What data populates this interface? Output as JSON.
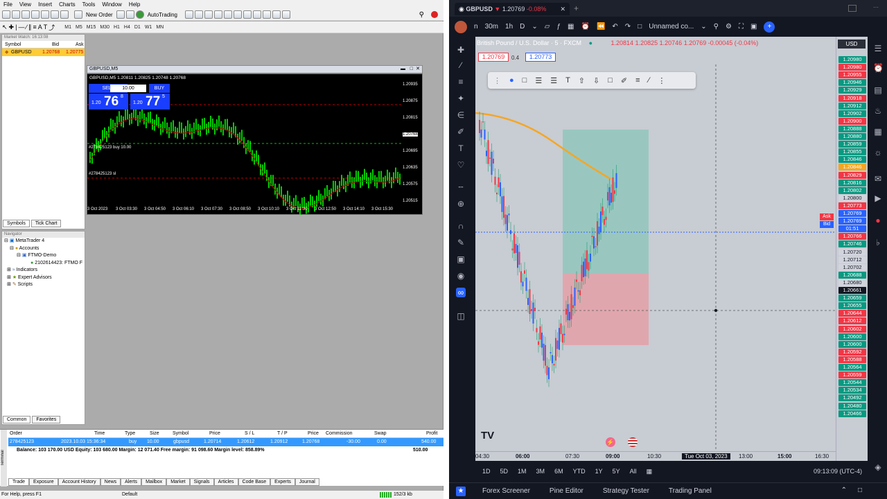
{
  "mt4": {
    "menu": [
      "File",
      "View",
      "Insert",
      "Charts",
      "Tools",
      "Window",
      "Help"
    ],
    "toolbar": {
      "new_order": "New Order",
      "autotrading": "AutoTrading"
    },
    "timeframes": [
      "M1",
      "M5",
      "M15",
      "M30",
      "H1",
      "H4",
      "D1",
      "W1",
      "MN"
    ],
    "market_watch": {
      "title": "Market Watch: 16:13:08",
      "headers": [
        "Symbol",
        "Bid",
        "Ask"
      ],
      "rows": [
        {
          "symbol": "GBPUSD",
          "bid": "1.20768",
          "ask": "1.20775"
        }
      ],
      "tabs": [
        "Symbols",
        "Tick Chart"
      ]
    },
    "navigator": {
      "title": "Navigator",
      "items": [
        "MetaTrader 4",
        "Accounts",
        "FTMO-Demo",
        "2102614423: FTMO F",
        "Indicators",
        "Expert Advisors",
        "Scripts"
      ],
      "tabs": [
        "Common",
        "Favorites"
      ]
    },
    "chart": {
      "title": "GBPUSD,M5",
      "ohlc": "GBPUSD,M5  1.20811 1.20825 1.20748 1.20768",
      "sell_label": "SELL",
      "buy_label": "BUY",
      "lot": "10.00",
      "sell_price_small": "1.20",
      "sell_price_big": "76",
      "sell_price_sup": "8",
      "buy_price_small": "1.20",
      "buy_price_big": "77",
      "buy_price_sup": "5",
      "order_label_1": "#278425123 buy 10.00",
      "order_label_2": "#278425123 sl",
      "price_scale": [
        "1.20935",
        "1.20875",
        "1.20815",
        "1.20768",
        "1.20695",
        "1.20635",
        "1.20575",
        "1.20515"
      ],
      "time_scale": [
        "3 Oct 2023",
        "3 Oct 03:30",
        "3 Oct 04:50",
        "3 Oct 06:10",
        "3 Oct 07:30",
        "3 Oct 08:50",
        "3 Oct 10:10",
        "3 Oct 11:30",
        "3 Oct 12:50",
        "3 Oct 14:10",
        "3 Oct 15:30"
      ]
    },
    "terminal": {
      "headers": [
        "Order",
        "Time",
        "Type",
        "Size",
        "Symbol",
        "Price",
        "S / L",
        "T / P",
        "Price",
        "Commission",
        "Swap",
        "Profit"
      ],
      "row": [
        "278425123",
        "2023.10.03 15:36:34",
        "buy",
        "10.00",
        "gbpusd",
        "1.20714",
        "1.20612",
        "1.20912",
        "1.20768",
        "-30.00",
        "0.00",
        "540.00"
      ],
      "balance_line": "Balance: 103 170.00 USD  Equity: 103 680.00  Margin: 12 071.40  Free margin: 91 098.60  Margin level: 858.89%",
      "balance_profit": "510.00",
      "tabs": [
        "Trade",
        "Exposure",
        "Account History",
        "News",
        "Alerts",
        "Mailbox",
        "Market",
        "Signals",
        "Articles",
        "Code Base",
        "Experts",
        "Journal"
      ],
      "side_label": "Terminal"
    },
    "status": {
      "help": "For Help, press F1",
      "profile": "Default",
      "traffic": "152/3 kb"
    }
  },
  "tv": {
    "tab_title": "GBPUSD",
    "tab_price": "1.20769",
    "tab_change": "-0.08%",
    "top": {
      "interval": "30m",
      "tf1": "1h",
      "tf2": "D",
      "layout": "Unnamed co..."
    },
    "legend": {
      "name": "British Pound / U.S. Dollar · 5 · FXCM",
      "o": "1.20814",
      "h": "1.20825",
      "l": "1.20746",
      "c": "1.20769",
      "chg": "-0.00045 (-0.04%)",
      "bid_box": "1.20769",
      "spread": "0.4",
      "ask_box": "1.20773"
    },
    "currency": "USD",
    "colors": {
      "up": "#2962ff",
      "down": "#f23645",
      "sma": "#f5a623",
      "tp_zone": "#7fc4b6",
      "sl_zone": "#e89aa2"
    },
    "price_labels": [
      {
        "v": "1.20980",
        "c": "#089981"
      },
      {
        "v": "1.20980",
        "c": "#f23645"
      },
      {
        "v": "1.20955",
        "c": "#f23645"
      },
      {
        "v": "1.20946",
        "c": "#089981"
      },
      {
        "v": "1.20929",
        "c": "#089981"
      },
      {
        "v": "1.20918",
        "c": "#f23645"
      },
      {
        "v": "1.20912",
        "c": "#089981"
      },
      {
        "v": "1.20902",
        "c": "#089981"
      },
      {
        "v": "1.20900",
        "c": "#f23645"
      },
      {
        "v": "1.20888",
        "c": "#089981"
      },
      {
        "v": "1.20880",
        "c": "#089981"
      },
      {
        "v": "1.20859",
        "c": "#089981"
      },
      {
        "v": "1.20855",
        "c": "#089981"
      },
      {
        "v": "1.20846",
        "c": "#089981"
      },
      {
        "v": "1.20846",
        "c": "#f5a623"
      },
      {
        "v": "1.20829",
        "c": "#f23645"
      },
      {
        "v": "1.20816",
        "c": "#089981"
      },
      {
        "v": "1.20802",
        "c": "#089981"
      },
      {
        "v": "1.20800",
        "c": "#d1d4dc"
      },
      {
        "v": "1.20773",
        "c": "#f23645"
      },
      {
        "v": "1.20769",
        "c": "#2962ff"
      },
      {
        "v": "1.20769",
        "c": "#2962ff"
      },
      {
        "v": "01:51",
        "c": "#2962ff"
      },
      {
        "v": "1.20766",
        "c": "#f23645"
      },
      {
        "v": "1.20746",
        "c": "#089981"
      },
      {
        "v": "1.20720",
        "c": "#d1d4dc"
      },
      {
        "v": "1.20712",
        "c": "#d1d4dc"
      },
      {
        "v": "1.20702",
        "c": "#d1d4dc"
      },
      {
        "v": "1.20688",
        "c": "#089981"
      },
      {
        "v": "1.20680",
        "c": "#d1d4dc"
      },
      {
        "v": "1.20661",
        "c": "#131722"
      },
      {
        "v": "1.20659",
        "c": "#089981"
      },
      {
        "v": "1.20655",
        "c": "#089981"
      },
      {
        "v": "1.20644",
        "c": "#f23645"
      },
      {
        "v": "1.20612",
        "c": "#f23645"
      },
      {
        "v": "1.20602",
        "c": "#f23645"
      },
      {
        "v": "1.20600",
        "c": "#089981"
      },
      {
        "v": "1.20600",
        "c": "#089981"
      },
      {
        "v": "1.20592",
        "c": "#f23645"
      },
      {
        "v": "1.20588",
        "c": "#f23645"
      },
      {
        "v": "1.20564",
        "c": "#089981"
      },
      {
        "v": "1.20559",
        "c": "#f23645"
      },
      {
        "v": "1.20544",
        "c": "#089981"
      },
      {
        "v": "1.20534",
        "c": "#089981"
      },
      {
        "v": "1.20492",
        "c": "#089981"
      },
      {
        "v": "1.20480",
        "c": "#089981"
      },
      {
        "v": "1.20466",
        "c": "#089981"
      }
    ],
    "ask_tag": "Ask",
    "bid_tag": "Bid",
    "time_axis": [
      "04:30",
      "06:00",
      "07:30",
      "09:00",
      "10:30",
      "Tue Oct 03, 2023",
      "13:00",
      "15:00",
      "16:30"
    ],
    "ranges": [
      "1D",
      "5D",
      "1M",
      "3M",
      "6M",
      "YTD",
      "1Y",
      "5Y",
      "All"
    ],
    "clock": "09:13:09 (UTC-4)",
    "footer": [
      "Forex Screener",
      "Pine Editor",
      "Strategy Tester",
      "Trading Panel"
    ],
    "logo": "TV"
  }
}
